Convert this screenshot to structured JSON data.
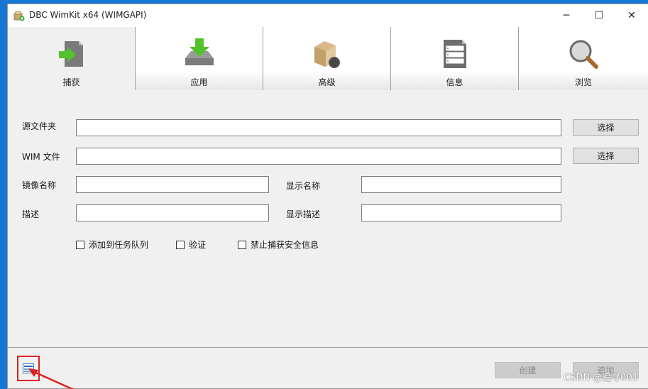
{
  "window": {
    "title": "DBC WimKit x64 (WIMGAPI)",
    "controls": {
      "minimize": "─",
      "maximize": "☐",
      "close": "✕"
    }
  },
  "tabs": [
    {
      "label": "捕获",
      "icon": "capture-icon",
      "active": true
    },
    {
      "label": "应用",
      "icon": "apply-icon",
      "active": false
    },
    {
      "label": "高级",
      "icon": "advanced-icon",
      "active": false
    },
    {
      "label": "信息",
      "icon": "info-icon",
      "active": false
    },
    {
      "label": "浏览",
      "icon": "browse-icon",
      "active": false
    }
  ],
  "form": {
    "source_folder_label": "源文件夹",
    "source_folder_value": "",
    "wim_file_label": "WIM 文件",
    "wim_file_value": "",
    "select_label": "选择",
    "image_name_label": "镜像名称",
    "image_name_value": "",
    "display_name_label": "显示名称",
    "display_name_value": "",
    "description_label": "描述",
    "description_value": "",
    "display_description_label": "显示描述",
    "display_description_value": ""
  },
  "options": [
    {
      "label": "添加到任务队列",
      "checked": false
    },
    {
      "label": "验证",
      "checked": false
    },
    {
      "label": "禁止捕获安全信息",
      "checked": false
    }
  ],
  "footer": {
    "create_label": "创建",
    "append_label": "追加"
  },
  "watermark": "CSDN @追寻001",
  "colors": {
    "desktop": "#1577d4",
    "window_bg": "#f0f0f0",
    "highlight_box": "#e02020"
  }
}
